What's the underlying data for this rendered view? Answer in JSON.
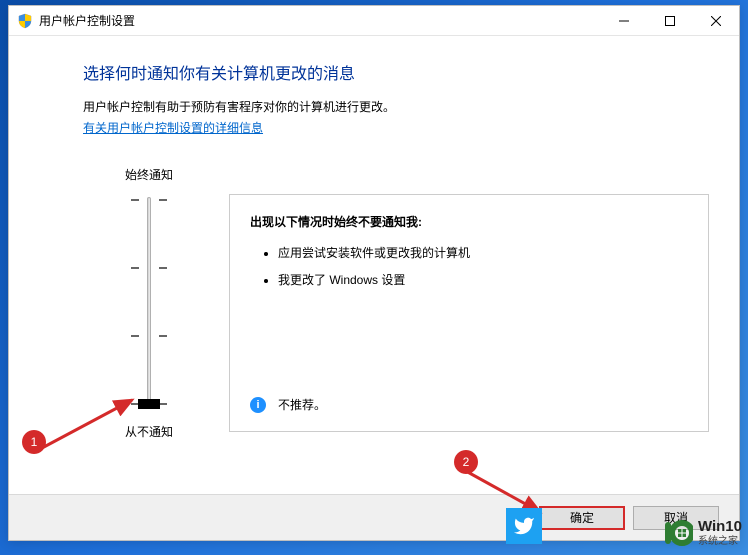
{
  "window": {
    "title": "用户帐户控制设置"
  },
  "content": {
    "heading": "选择何时通知你有关计算机更改的消息",
    "description": "用户帐户控制有助于预防有害程序对你的计算机进行更改。",
    "link": "有关用户帐户控制设置的详细信息"
  },
  "slider": {
    "top_label": "始终通知",
    "bottom_label": "从不通知"
  },
  "info": {
    "title": "出现以下情况时始终不要通知我:",
    "bullets": [
      "应用尝试安装软件或更改我的计算机",
      "我更改了 Windows 设置"
    ],
    "recommend": "不推荐。"
  },
  "footer": {
    "ok": "确定",
    "cancel": "取消"
  },
  "annotations": {
    "badge1": "1",
    "badge2": "2"
  },
  "watermark": {
    "line1": "Win10",
    "line2": "系统之家"
  }
}
